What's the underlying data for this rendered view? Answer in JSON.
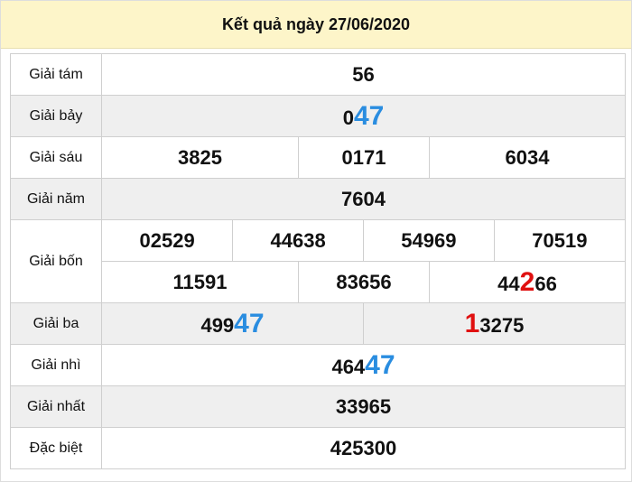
{
  "title": "Kết quả ngày 27/06/2020",
  "colors": {
    "highlight_blue": "#2a8de0",
    "highlight_red": "#e01010",
    "header_bg": "#fdf5c9"
  },
  "rows": {
    "g8": {
      "label": "Giải tám",
      "value": "56"
    },
    "g7": {
      "label": "Giải bảy",
      "prefix": "0",
      "highlight": "47"
    },
    "g6": {
      "label": "Giải sáu",
      "values": [
        "3825",
        "0171",
        "6034"
      ]
    },
    "g5": {
      "label": "Giải năm",
      "value": "7604"
    },
    "g4": {
      "label": "Giải bốn",
      "row1": [
        "02529",
        "44638",
        "54969",
        "70519"
      ],
      "row2": [
        "11591",
        "83656"
      ],
      "hl_prefix": "44",
      "hl_digit": "2",
      "hl_suffix": "66"
    },
    "g3": {
      "label": "Giải ba",
      "a_prefix": "499",
      "a_highlight": "47",
      "b_highlight": "1",
      "b_suffix": "3275"
    },
    "g2": {
      "label": "Giải nhì",
      "prefix": "464",
      "highlight": "47"
    },
    "g1": {
      "label": "Giải nhất",
      "value": "33965"
    },
    "db": {
      "label": "Đặc biệt",
      "value": "425300"
    }
  }
}
